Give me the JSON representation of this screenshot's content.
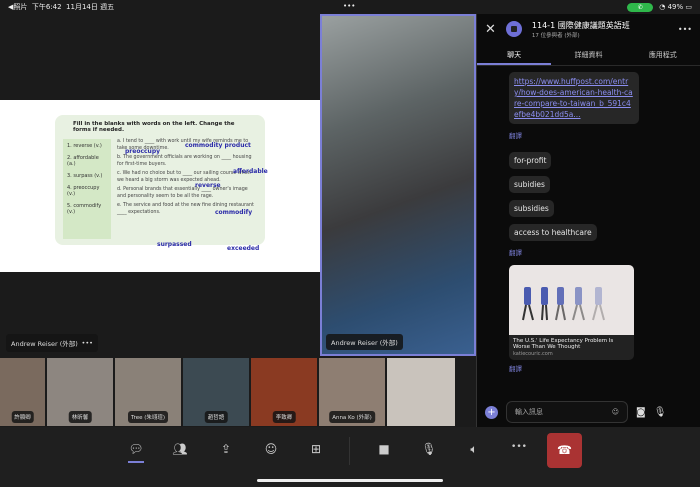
{
  "status": {
    "back": "◀照片",
    "time": "下午6:42",
    "date": "11月14日 週五",
    "dots": "•••",
    "battery": "49%"
  },
  "slide": {
    "question": "Fill in the blanks with words on the left. Change the forms if needed.",
    "words": [
      "1. reverse (v.)",
      "2. affordable (a.)",
      "3. surpass (v.)",
      "4. preoccupy (v.)",
      "5. commodify (v.)"
    ],
    "sentences": [
      "a. I tend to ____ with work until my wife reminds me to take some downtime.",
      "b. The government officials are working on ____ housing for first-time buyers.",
      "c. We had no choice but to ____ our sailing course when we heard a big storm was expected ahead.",
      "d. Personal brands that essentially ____ owner's image and personality seem to be all the rage.",
      "e. The service and food at the new fine dining restaurant ____ expectations."
    ],
    "annotations": [
      "commodity product",
      "preoccupy",
      "affordable",
      "reverse",
      "commodify",
      "surpassed",
      "exceeded"
    ]
  },
  "spotlight": {
    "name": "Andrew Reiser (外部)"
  },
  "presenter": {
    "name": "Andrew Reiser (外部)",
    "more": "•••"
  },
  "participants": [
    {
      "name": "許顥卿"
    },
    {
      "name": "林昕馨"
    },
    {
      "name": "Tree (朱翊瑄)"
    },
    {
      "name": "趙哲語"
    },
    {
      "name": "李致卿"
    },
    {
      "name": "Anna Ko (外部)"
    },
    {
      "name": ""
    }
  ],
  "chat": {
    "title": "114-1 國際健康議題英語班",
    "subtitle": "17 位參與者 (外部)",
    "tabs": [
      "聊天",
      "詳細資料",
      "應用程式"
    ],
    "link": "https://www.huffpost.com/entry/how-does-american-health-care-compare-to-taiwan_b_591c4efbe4b021dd5a...",
    "translate": "翻譯",
    "messages": [
      "for-profit",
      "subidies",
      "subsidies",
      "access to healthcare"
    ],
    "card": {
      "title": "The U.S.' Life Expectancy Problem Is Worse Than We Thought",
      "source": "katiecouric.com"
    },
    "placeholder": "輸入訊息"
  }
}
